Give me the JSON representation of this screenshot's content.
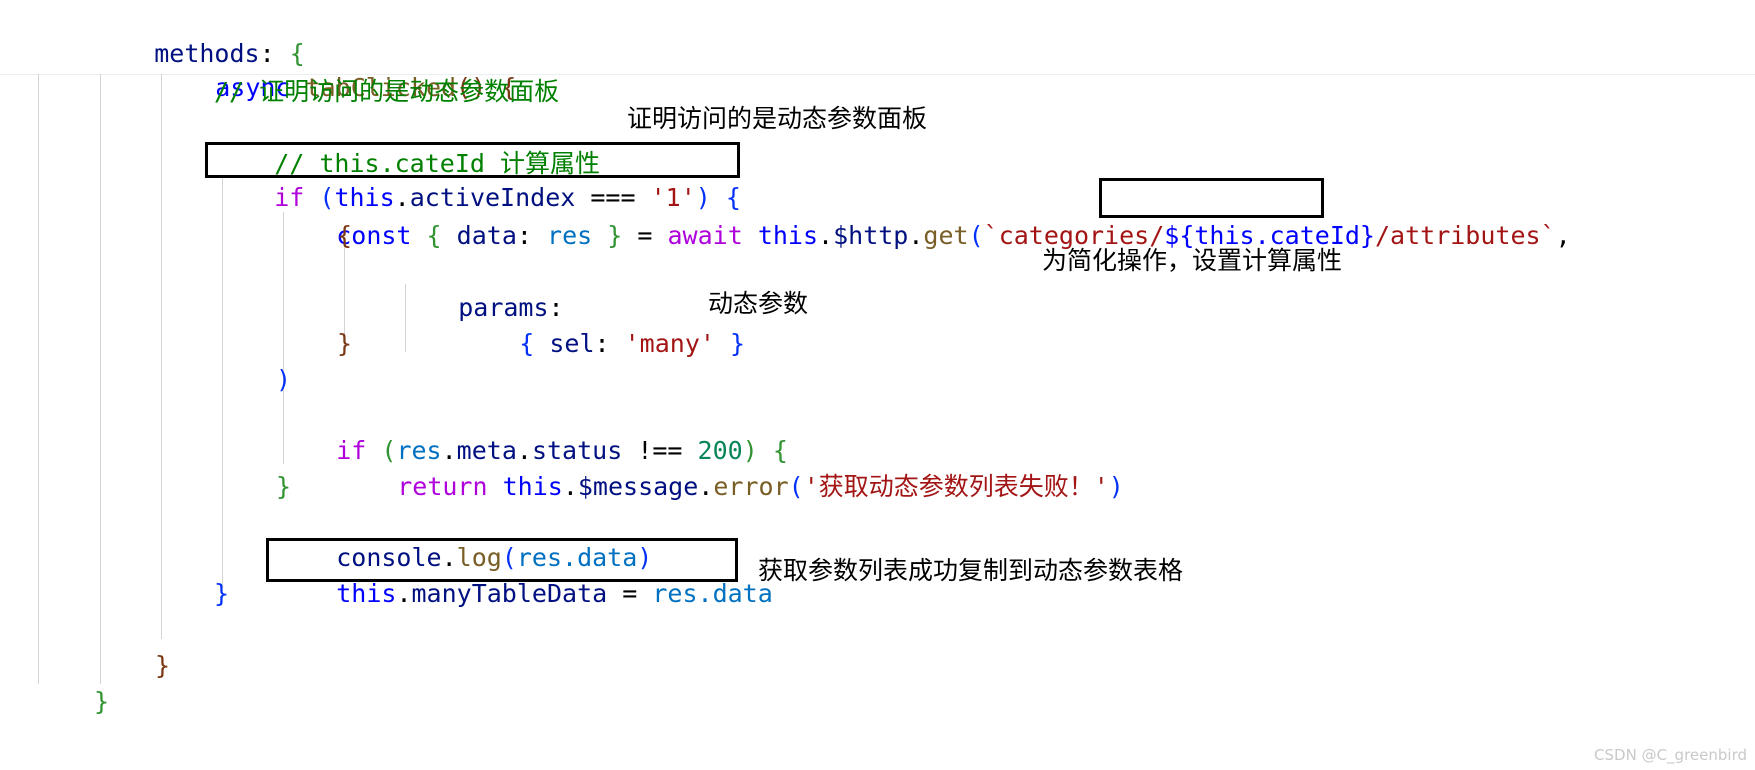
{
  "editor": {
    "language": "javascript",
    "font_size_px": 25,
    "background": "#ffffff",
    "code_lines": [
      {
        "id": "l1",
        "text": "methods: {"
      },
      {
        "id": "l2",
        "text": "async tabClicked() {"
      },
      {
        "id": "l3",
        "text": "// 证明访问的是动态参数面板"
      },
      {
        "id": "l4",
        "text": "// this.cateId 计算属性"
      },
      {
        "id": "l5",
        "text": "if (this.activeIndex === '1') {"
      },
      {
        "id": "l6",
        "text": "const { data: res } = await this.$http.get(`categories/${this.cateId}/attributes`,"
      },
      {
        "id": "l7",
        "text": "{"
      },
      {
        "id": "l8",
        "text": "params:"
      },
      {
        "id": "l9",
        "text": "{ sel: 'many' }"
      },
      {
        "id": "l10",
        "text": "}"
      },
      {
        "id": "l11",
        "text": ")"
      },
      {
        "id": "l12",
        "text": "if (res.meta.status !== 200) {"
      },
      {
        "id": "l13",
        "text": "return this.$message.error('获取动态参数列表失败！')"
      },
      {
        "id": "l14",
        "text": "}"
      },
      {
        "id": "l15",
        "text": "console.log(res.data)"
      },
      {
        "id": "l16",
        "text": "this.manyTableData = res.data"
      },
      {
        "id": "l17",
        "text": "}"
      },
      {
        "id": "l18",
        "text": "}"
      },
      {
        "id": "l19",
        "text": "}"
      }
    ],
    "tokens": {
      "methods": "methods",
      "colon": ":",
      "brace_open": "{",
      "brace_close": "}",
      "async": "async",
      "tabClicked": "tabClicked",
      "parens_empty": "()",
      "comment_1": "// 证明访问的是动态参数面板",
      "comment_2_slashes": "// ",
      "comment_2_code": "this.cateId",
      "comment_2_text": " 计算属性",
      "if": "if",
      "this": "this",
      "activeIndex": "activeIndex",
      "strict_eq": "===",
      "str_one": "'1'",
      "const": "const",
      "data": "data",
      "res": "res",
      "assign": "=",
      "await": "await",
      "http": "$http",
      "get": "get",
      "tpl_prefix": "`categories/",
      "tpl_expr": "${this.cateId}",
      "tpl_suffix": "/attributes`",
      "comma": ",",
      "params": "params",
      "sel": "sel",
      "str_many": "'many'",
      "meta": "meta",
      "status": "status",
      "not_eq": "!==",
      "num_200": "200",
      "return": "return",
      "message": "$message",
      "error": "error",
      "str_error": "'获取动态参数列表失败！'",
      "console": "console",
      "log": "log",
      "res_data": "res.data",
      "manyTableData": "manyTableData"
    }
  },
  "annotations": {
    "notes": [
      {
        "id": "n1",
        "text": "证明访问的是动态参数面板"
      },
      {
        "id": "n2",
        "text": "为简化操作，设置计算属性"
      },
      {
        "id": "n3",
        "text": "动态参数"
      },
      {
        "id": "n4",
        "text": "获取参数列表成功复制到动态参数表格"
      }
    ],
    "boxes": [
      {
        "id": "b1",
        "label": "if-condition-highlight"
      },
      {
        "id": "b2",
        "label": "template-expression-highlight"
      },
      {
        "id": "b3",
        "label": "assignment-highlight"
      }
    ],
    "box_color": "#000000"
  },
  "watermark": {
    "text": "CSDN @C_greenbird",
    "color": "#c9c9c9"
  }
}
